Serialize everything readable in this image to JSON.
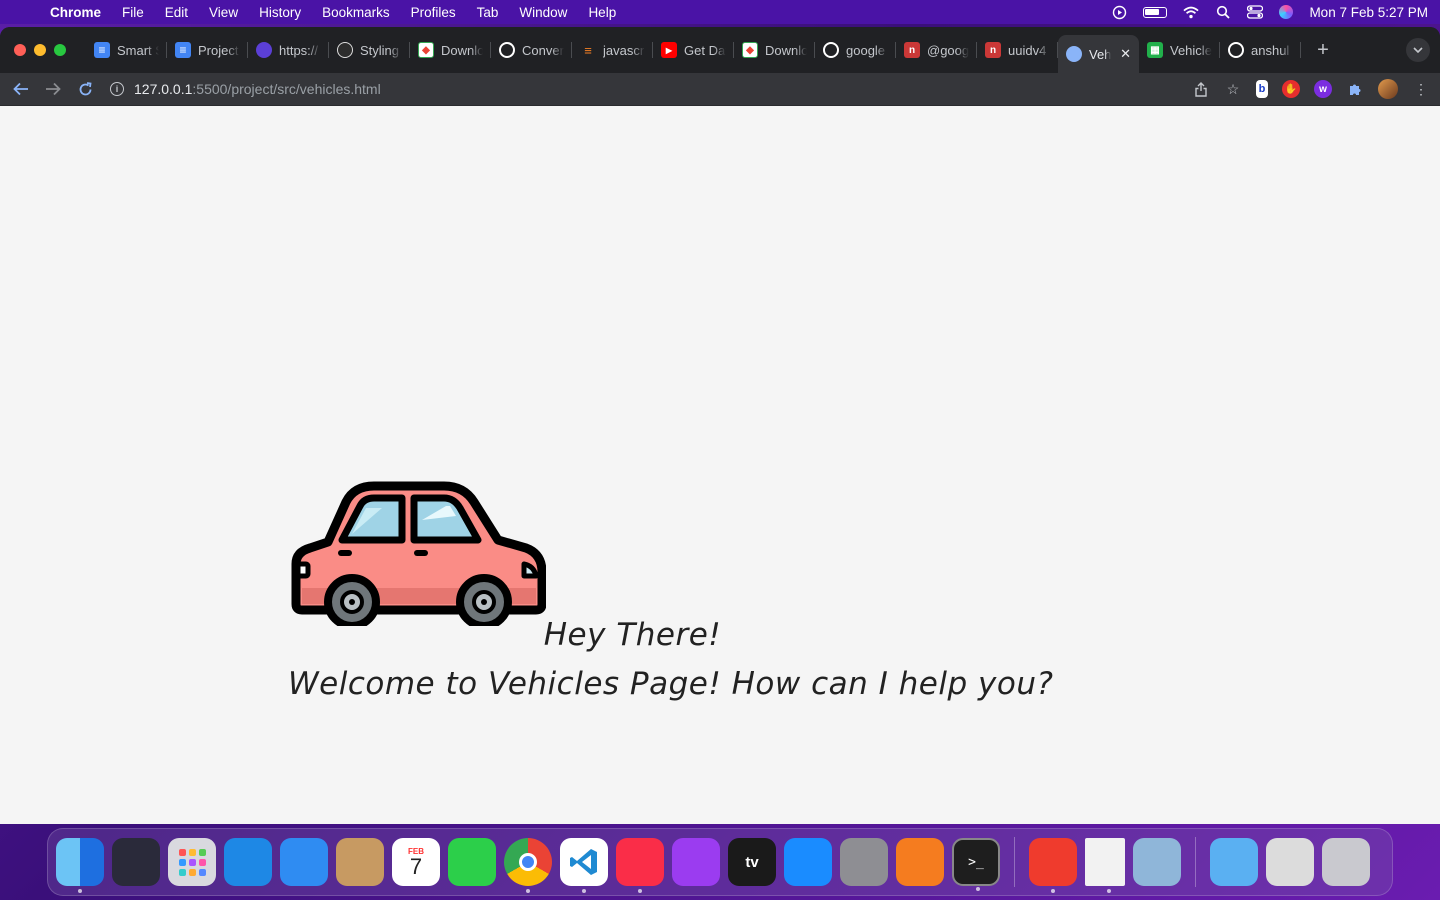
{
  "menubar": {
    "app_name": "Chrome",
    "menus": [
      "File",
      "Edit",
      "View",
      "History",
      "Bookmarks",
      "Profiles",
      "Tab",
      "Window",
      "Help"
    ],
    "datetime": "Mon 7 Feb  5:27 PM"
  },
  "tabs": [
    {
      "title": "Smart S",
      "icon": "google-docs-icon",
      "color": "#4285f4"
    },
    {
      "title": "Project",
      "icon": "google-docs-icon",
      "color": "#4285f4"
    },
    {
      "title": "https://",
      "icon": "globe-icon",
      "color": "#5b3fd6"
    },
    {
      "title": "Styling",
      "icon": "styling-site-icon",
      "color": "#2d2d2d"
    },
    {
      "title": "Download",
      "icon": "download-site-icon",
      "color": "#ffffff"
    },
    {
      "title": "Convert",
      "icon": "github-icon",
      "color": "#202124"
    },
    {
      "title": "javascript",
      "icon": "stackoverflow-icon",
      "color": "#f48024"
    },
    {
      "title": "Get Data",
      "icon": "youtube-icon",
      "color": "#ff0000"
    },
    {
      "title": "Download",
      "icon": "download-site-icon",
      "color": "#ffffff"
    },
    {
      "title": "google",
      "icon": "github-icon",
      "color": "#202124"
    },
    {
      "title": "@goog",
      "icon": "npm-icon",
      "color": "#cb3837"
    },
    {
      "title": "uuidv4",
      "icon": "npm-icon",
      "color": "#cb3837"
    },
    {
      "title": "Veh",
      "icon": "globe-icon",
      "color": "#8ab4f8",
      "active": true
    },
    {
      "title": "Vehicle",
      "icon": "sheets-icon",
      "color": "#21b04b"
    },
    {
      "title": "anshul",
      "icon": "github-icon",
      "color": "#202124"
    }
  ],
  "toolbar": {
    "url_host": "127.0.0.1",
    "url_path": ":5500/project/src/vehicles.html"
  },
  "page": {
    "greeting": "Hey There!",
    "welcome": "Welcome to Vehicles Page! How can I help you?"
  },
  "dock": {
    "apps": [
      {
        "name": "finder-icon",
        "color": "#3a8ee6",
        "running": true
      },
      {
        "name": "siri-icon",
        "color": "#2a2a3a",
        "running": false
      },
      {
        "name": "launchpad-icon",
        "color": "#d9d9df",
        "running": false
      },
      {
        "name": "safari-icon",
        "color": "#1e88e5",
        "running": false
      },
      {
        "name": "mail-icon",
        "color": "#2f8cf2",
        "running": false
      },
      {
        "name": "contacts-icon",
        "color": "#c79a62",
        "running": false
      },
      {
        "name": "calendar-icon",
        "color": "#ffffff",
        "running": false
      },
      {
        "name": "facetime-icon",
        "color": "#2ccf4a",
        "running": false
      },
      {
        "name": "chrome-icon",
        "color": "#ffffff",
        "running": true
      },
      {
        "name": "vscode-icon",
        "color": "#ffffff",
        "running": true
      },
      {
        "name": "music-icon",
        "color": "#fa2d48",
        "running": true
      },
      {
        "name": "podcasts-icon",
        "color": "#9b3cf0",
        "running": false
      },
      {
        "name": "appletv-icon",
        "color": "#1a1a1a",
        "running": false
      },
      {
        "name": "appstore-icon",
        "color": "#1a8cff",
        "running": false
      },
      {
        "name": "system-preferences-icon",
        "color": "#8e8e93",
        "running": false
      },
      {
        "name": "pages-icon",
        "color": "#f57c1f",
        "running": false
      },
      {
        "name": "terminal-icon",
        "color": "#1e1e1e",
        "running": true
      }
    ],
    "recent": [
      {
        "name": "anydesk-icon",
        "color": "#ef3b2d",
        "running": true
      },
      {
        "name": "document-icon",
        "color": "#f2f2f2",
        "running": true
      },
      {
        "name": "preview-icon",
        "color": "#8fb6d9",
        "running": false
      }
    ],
    "stacks": [
      {
        "name": "applications-folder-icon",
        "color": "#5ab0f2"
      },
      {
        "name": "downloads-stack-icon",
        "color": "#dcdcdc"
      },
      {
        "name": "trash-icon",
        "color": "#c9c9cf"
      }
    ],
    "calendar_month": "FEB",
    "calendar_day": "7",
    "appletv_label": "tv"
  }
}
